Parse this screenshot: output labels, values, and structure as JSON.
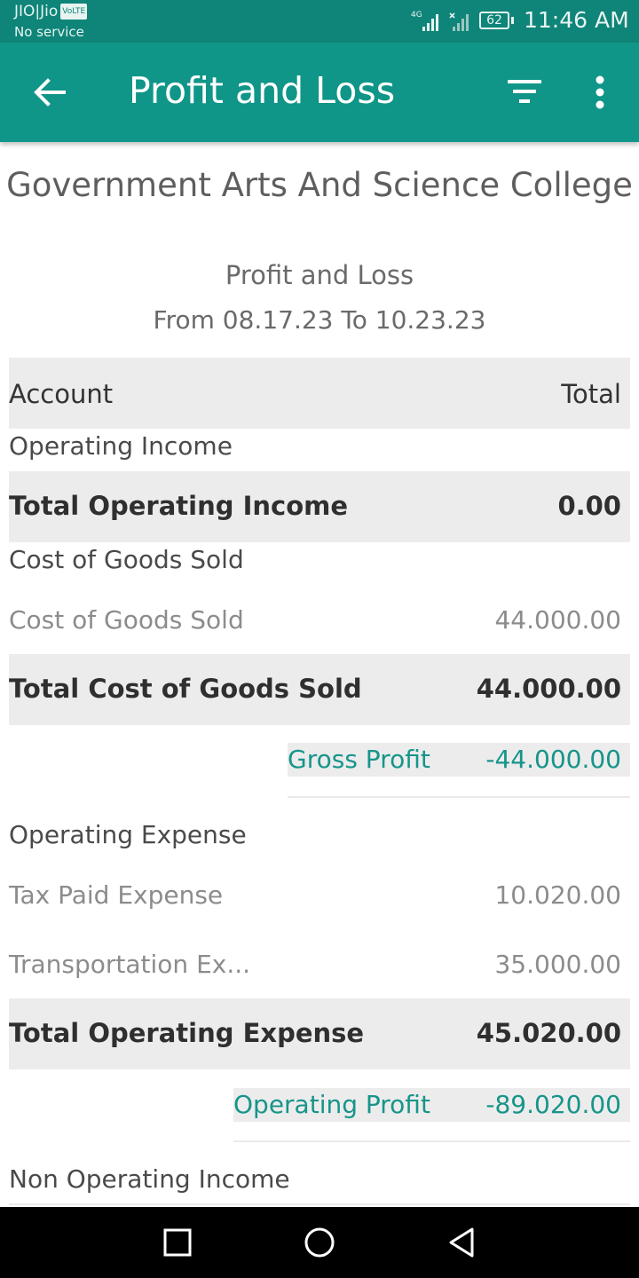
{
  "status_bar": {
    "carrier": "JIO|Jio",
    "volte": "VoLTE",
    "service": "No service",
    "network_badge": "4G",
    "battery": "62",
    "time": "11:46 AM"
  },
  "app_bar": {
    "title": "Profit and Loss",
    "icons": [
      "back-arrow-icon",
      "filter-icon",
      "more-vert-icon"
    ]
  },
  "report": {
    "organization": "Government Arts And Science College",
    "title": "Profit and Loss",
    "date_range": "From 08.17.23 To 10.23.23"
  },
  "table_header": {
    "account": "Account",
    "total": "Total"
  },
  "operating_income": {
    "section": "Operating Income",
    "total_label": "Total Operating Income",
    "total_value": "0.00"
  },
  "cogs": {
    "section": "Cost of Goods Sold",
    "items": [
      {
        "label": "Cost of Goods Sold",
        "value": "44.000.00"
      }
    ],
    "total_label": "Total Cost of Goods Sold",
    "total_value": "44.000.00"
  },
  "gross_profit": {
    "label": "Gross Profit",
    "value": "-44.000.00"
  },
  "operating_expense": {
    "section": "Operating Expense",
    "items": [
      {
        "label": "Tax Paid Expense",
        "value": "10.020.00"
      },
      {
        "label": "Transportation Ex...",
        "value": "35.000.00"
      }
    ],
    "total_label": "Total Operating Expense",
    "total_value": "45.020.00"
  },
  "operating_profit": {
    "label": "Operating Profit",
    "value": "-89.020.00"
  },
  "non_operating_income": {
    "section": "Non Operating Income"
  },
  "colors": {
    "primary": "#0f9688",
    "primary_dark": "#0e8578",
    "accent_text": "#16958a",
    "row_highlight": "#ececec"
  }
}
